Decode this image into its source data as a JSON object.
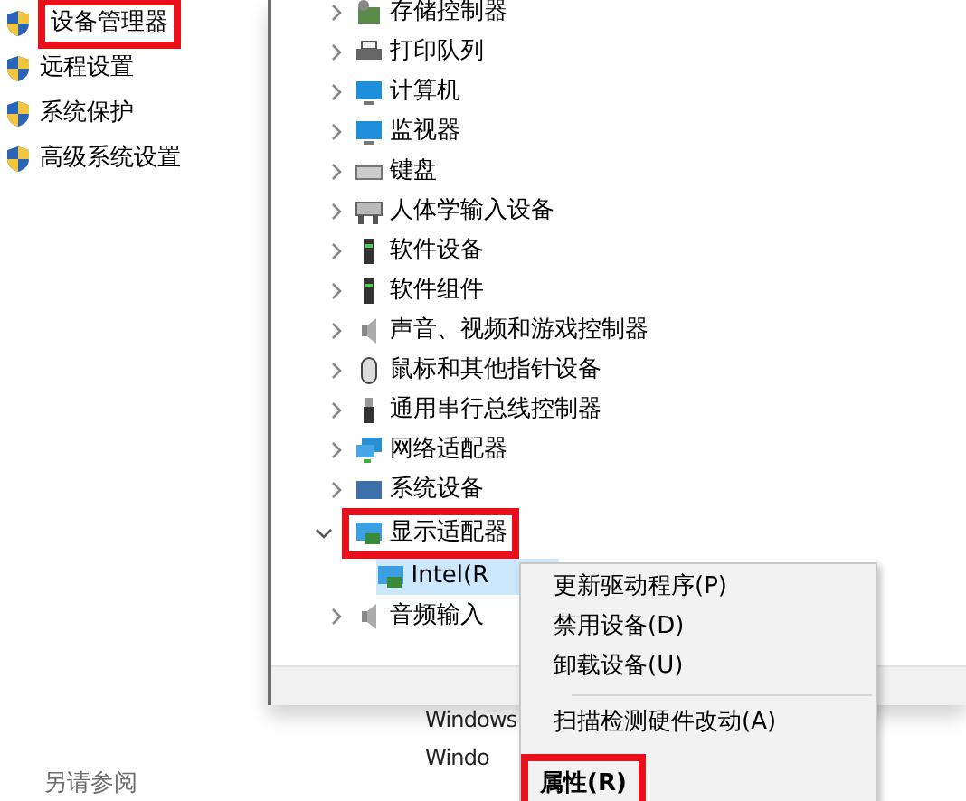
{
  "sidebar": {
    "items": [
      {
        "label": "设备管理器",
        "highlighted": true
      },
      {
        "label": "远程设置",
        "highlighted": false
      },
      {
        "label": "系统保护",
        "highlighted": false
      },
      {
        "label": "高级系统设置",
        "highlighted": false
      }
    ],
    "see_also": "另请参阅"
  },
  "device_tree": {
    "nodes": [
      {
        "label": "存储控制器",
        "kind": "storage",
        "expanded": false
      },
      {
        "label": "打印队列",
        "kind": "printer",
        "expanded": false
      },
      {
        "label": "计算机",
        "kind": "monitor",
        "expanded": false
      },
      {
        "label": "监视器",
        "kind": "monitor",
        "expanded": false
      },
      {
        "label": "键盘",
        "kind": "keyboard",
        "expanded": false
      },
      {
        "label": "人体学输入设备",
        "kind": "hid",
        "expanded": false
      },
      {
        "label": "软件设备",
        "kind": "software",
        "expanded": false
      },
      {
        "label": "软件组件",
        "kind": "software",
        "expanded": false
      },
      {
        "label": "声音、视频和游戏控制器",
        "kind": "speaker",
        "expanded": false
      },
      {
        "label": "鼠标和其他指针设备",
        "kind": "mouse",
        "expanded": false
      },
      {
        "label": "通用串行总线控制器",
        "kind": "usb",
        "expanded": false
      },
      {
        "label": "网络适配器",
        "kind": "network",
        "expanded": false
      },
      {
        "label": "系统设备",
        "kind": "system",
        "expanded": false
      },
      {
        "label": "显示适配器",
        "kind": "display",
        "expanded": true,
        "highlighted": true,
        "children": [
          {
            "label": "Intel(R",
            "kind": "display",
            "selected": true
          }
        ]
      },
      {
        "label": "音频输入",
        "kind": "speaker",
        "expanded": false
      }
    ]
  },
  "background_texts": [
    "Windows",
    "Windo"
  ],
  "context_menu": {
    "items": [
      {
        "label": "更新驱动程序(P)",
        "kind": "item"
      },
      {
        "label": "禁用设备(D)",
        "kind": "item"
      },
      {
        "label": "卸载设备(U)",
        "kind": "item"
      },
      {
        "kind": "separator"
      },
      {
        "label": "扫描检测硬件改动(A)",
        "kind": "item"
      },
      {
        "label": "属性(R)",
        "kind": "item",
        "bold": true,
        "highlighted": true
      }
    ]
  }
}
